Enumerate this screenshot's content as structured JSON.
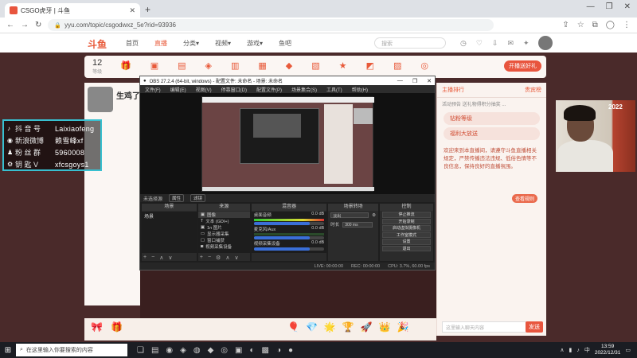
{
  "browser": {
    "tab_title": "CSGO虎牙 | 斗鱼",
    "url": "yyu.com/topic/csgodwxz_5e?rid=93936",
    "window_controls": [
      "—",
      "❐",
      "✕"
    ]
  },
  "site": {
    "logo": "斗鱼",
    "nav": [
      "首页",
      "直播",
      "分类▾",
      "视频▾",
      "游戏▾",
      "鱼吧"
    ],
    "search_placeholder": "搜索",
    "level_number": "12",
    "level_label": "等级",
    "promo_button": "开播送好礼",
    "stream_title": "生鸡了"
  },
  "right_panel": {
    "tab_left": "主播排行",
    "tab_right": "贵宾榜",
    "line1": "活动预告 送礼物得积分抽奖 ...",
    "badge1": "钻粉等级",
    "badge2": "福利大放送",
    "chat": "欢迎来到本直播间，请遵守斗鱼直播相关规定，严禁传播违法违规、低俗色情等不良信息，保持良好的直播氛围。",
    "chat_btn": "查看规则",
    "input_placeholder": "这里输入聊天内容",
    "send_label": "发送"
  },
  "overlay": {
    "rows": [
      {
        "icon": "douyin-icon",
        "glyph": "♪",
        "key": "抖 音 号",
        "value": "Laixiaofeng"
      },
      {
        "icon": "weibo-icon",
        "glyph": "◉",
        "key": "新浪微博",
        "value": "赖雪峰xf"
      },
      {
        "icon": "fans-icon",
        "glyph": "♟",
        "key": "粉 丝 群",
        "value": "5960008"
      },
      {
        "icon": "key-icon",
        "glyph": "⚙",
        "key": "钥 匙 V",
        "value": "xfcsgoys1"
      }
    ]
  },
  "webcam": {
    "sign_text": "2022"
  },
  "obs": {
    "title": "OBS 27.2.4 (64-bit, windows) - 配置文件: 未命名 - 场景: 未命名",
    "menu": [
      "文件(F)",
      "编辑(E)",
      "视图(V)",
      "停靠窗口(D)",
      "配置文件(P)",
      "场景集合(S)",
      "工具(T)",
      "帮助(H)"
    ],
    "scene_bar_label": "未选择源",
    "scene_bar_btn1": "属性",
    "scene_bar_btn2": "滤镜",
    "dock_scenes": "场景",
    "dock_sources": "来源",
    "dock_mixer": "混音器",
    "dock_transitions": "场景转场",
    "dock_controls": "控制",
    "scene_item": "场景",
    "sources": [
      "图像",
      "文本 (GDI+)",
      "1n 图片",
      "显示器采集",
      "窗口捕获",
      "视频采集设备"
    ],
    "mixer": [
      {
        "name": "桌面音频",
        "db": "0.0 dB"
      },
      {
        "name": "麦克风/Aux",
        "db": "0.0 dB"
      },
      {
        "name": "视频采集设备",
        "db": "0.0 dB"
      }
    ],
    "transition_type": "淡出",
    "duration_label": "时长",
    "duration_value": "300 ms",
    "controls": [
      "停止推流",
      "开始录制",
      "启动虚拟摄像机",
      "工作室模式",
      "设置",
      "退出"
    ],
    "status": [
      "LIVE: 00:00:00",
      "REC: 00:00:00",
      "CPU: 3.7%, 60.00 fps"
    ]
  },
  "taskbar": {
    "search_placeholder": "在这里输入你要搜索的内容",
    "tray": "中",
    "time": "13:59",
    "date": "2022/12/31"
  }
}
